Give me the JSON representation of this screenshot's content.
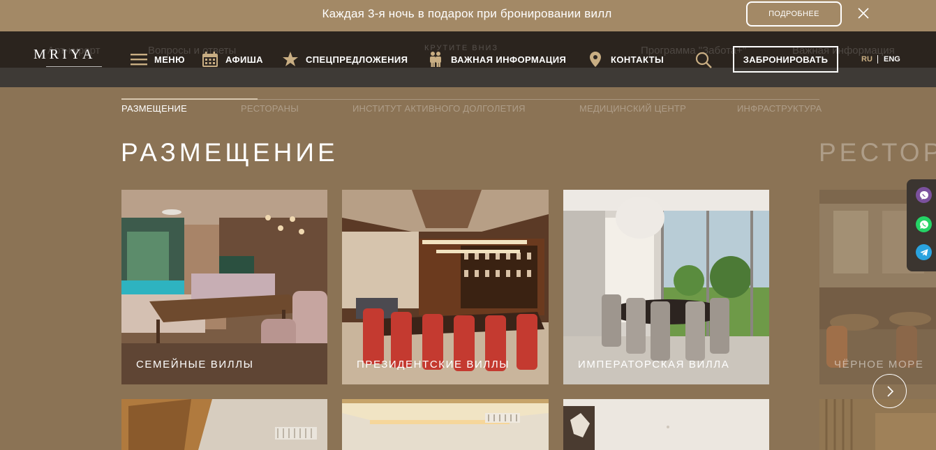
{
  "promo": {
    "text": "Каждая 3-я ночь в подарок при бронировании вилл",
    "button": "ПОДРОБНЕЕ"
  },
  "background_nav": {
    "item1": "Арт-курорт",
    "item2": "Вопросы и ответы",
    "scroll_hint": "КРУТИТЕ ВНИЗ",
    "item3": "Программа \"Забота+\"",
    "item4": "Важная информация"
  },
  "logo": "MRIYA",
  "nav": {
    "menu": "МЕНЮ",
    "afisha": "АФИША",
    "special": "СПЕЦПРЕДЛОЖЕНИЯ",
    "important": "ВАЖНАЯ ИНФОРМАЦИЯ",
    "contacts": "КОНТАКТЫ",
    "book": "ЗАБРОНИРОВАТЬ",
    "lang_ru": "RU",
    "lang_en": "ENG"
  },
  "tabs": [
    "РАЗМЕЩЕНИЕ",
    "РЕСТОРАНЫ",
    "ИНСТИТУТ АКТИВНОГО ДОЛГОЛЕТИЯ",
    "МЕДИЦИНСКИЙ ЦЕНТР",
    "ИНФРАСТРУКТУРА"
  ],
  "section_title": "РАЗМЕЩЕНИЕ",
  "next_section_title": "РЕСТОРАНЫ",
  "cards": [
    "СЕМЕЙНЫЕ ВИЛЛЫ",
    "ПРЕЗИДЕНТСКИЕ ВИЛЛЫ",
    "ИМПЕРАТОРСКАЯ ВИЛЛА",
    "ЧЁРНОЕ МОРЕ"
  ],
  "colors": {
    "background": "#8b7355",
    "promo_bar": "#a38966",
    "nav_bar": "#231e1a",
    "viber": "#7b519d",
    "whatsapp": "#25d366",
    "telegram": "#2aa3df"
  }
}
